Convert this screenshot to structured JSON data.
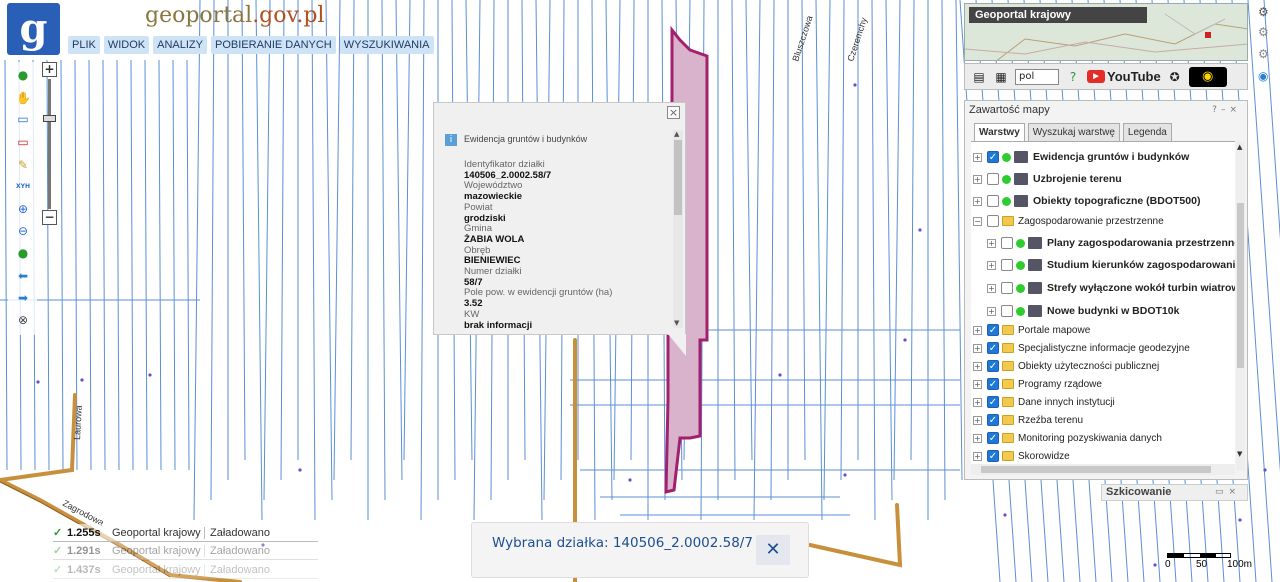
{
  "brand": {
    "name_part1": "geoportal",
    "name_part2": ".gov.pl",
    "logo_letter": "g"
  },
  "menu": [
    "PLIK",
    "WIDOK",
    "ANALIZY",
    "POBIERANIE DANYCH",
    "WYSZUKIWANIA"
  ],
  "map": {
    "road_label_1": "Laurowa",
    "road_label_2": "Zagrodowa",
    "road_label_3": "Bluszczowa",
    "road_label_4": "Czeremchy"
  },
  "popup": {
    "title": "Ewidencja gruntów i budynków",
    "fields": [
      {
        "label": "Identyfikator działki",
        "value": "140506_2.0002.58/7"
      },
      {
        "label": "Województwo",
        "value": "mazowieckie"
      },
      {
        "label": "Powiat",
        "value": "grodziski"
      },
      {
        "label": "Gmina",
        "value": "ŻABIA WOLA"
      },
      {
        "label": "Obręb",
        "value": "BIENIEWIEC"
      },
      {
        "label": "Numer działki",
        "value": "58/7"
      },
      {
        "label": "Pole pow. w ewidencji gruntów (ha)",
        "value": "3.52"
      },
      {
        "label": "KW",
        "value": "brak informacji"
      }
    ]
  },
  "overview": {
    "label": "Geoportal krajowy"
  },
  "toprow": {
    "language": "pol",
    "youtube_label": "YouTube"
  },
  "contents": {
    "title": "Zawartość mapy",
    "tabs": [
      "Warstwy",
      "Wyszukaj warstwę",
      "Legenda"
    ],
    "layers": [
      {
        "name": "Ewidencja gruntów i budynków",
        "checked": true
      },
      {
        "name": "Uzbrojenie terenu",
        "checked": false
      },
      {
        "name": "Obiekty topograficzne (BDOT500)",
        "checked": false
      },
      {
        "name": "Zagospodarowanie przestrzenne",
        "checked": false
      },
      {
        "name": "Plany zagospodarowania przestrzennego",
        "checked": false
      },
      {
        "name": "Studium kierunków zagospodarowania",
        "checked": false
      },
      {
        "name": "Strefy wyłączone wokół turbin wiatrowych",
        "checked": false
      },
      {
        "name": "Nowe budynki w BDOT10k",
        "checked": false
      },
      {
        "name": "Portale mapowe",
        "checked": true
      },
      {
        "name": "Specjalistyczne informacje geodezyjne",
        "checked": true
      },
      {
        "name": "Obiekty użyteczności publicznej",
        "checked": true
      },
      {
        "name": "Programy rządowe",
        "checked": true
      },
      {
        "name": "Dane innych instytucji",
        "checked": true
      },
      {
        "name": "Rzeźba terenu",
        "checked": true
      },
      {
        "name": "Monitoring pozyskiwania danych",
        "checked": true
      },
      {
        "name": "Skorowidze",
        "checked": true
      }
    ]
  },
  "sketch": {
    "label": "Szkicowanie"
  },
  "status": [
    {
      "time": "1.255s",
      "source": "Geoportal krajowy",
      "state": "Załadowano"
    },
    {
      "time": "1.291s",
      "source": "Geoportal krajowy",
      "state": "Załadowano"
    },
    {
      "time": "1.437s",
      "source": "Geoportal krajowy",
      "state": "Załadowano"
    }
  ],
  "selection": {
    "text": "Wybrana działka: 140506_2.0002.58/7"
  },
  "scale": {
    "labels": [
      "0",
      "50",
      "100m"
    ]
  },
  "colors": {
    "parcel_fill": "#d9b3cc",
    "parcel_stroke": "#a3206d",
    "road": "#c8903c",
    "parcel_lines": "#5b8fd6",
    "accent": "#1d4f91"
  }
}
